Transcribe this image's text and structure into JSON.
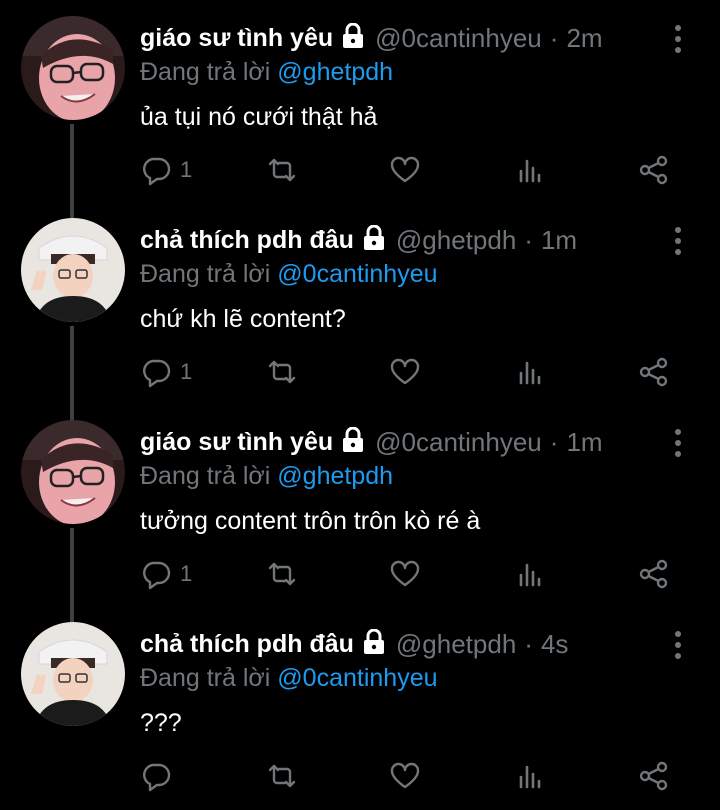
{
  "tweets": [
    {
      "name": "giáo sư tình yêu",
      "handle": "@0cantinhyeu",
      "dot": "·",
      "time": "2m",
      "reply_prefix": "Đang trả lời",
      "reply_to": "@ghetpdh",
      "text": "ủa tụi nó cưới thật hả",
      "reply_count": "1",
      "avatar": "pink-glasses-avatar"
    },
    {
      "name": "chả thích pdh đâu",
      "handle": "@ghetpdh",
      "dot": "·",
      "time": "1m",
      "reply_prefix": "Đang trả lời",
      "reply_to": "@0cantinhyeu",
      "text": "chứ kh lẽ content?",
      "reply_count": "1",
      "avatar": "peace-sign-avatar"
    },
    {
      "name": "giáo sư tình yêu",
      "handle": "@0cantinhyeu",
      "dot": "·",
      "time": "1m",
      "reply_prefix": "Đang trả lời",
      "reply_to": "@ghetpdh",
      "text": "tưởng content trôn trôn kò ré à",
      "reply_count": "1",
      "avatar": "pink-glasses-avatar"
    },
    {
      "name": "chả thích pdh đâu",
      "handle": "@ghetpdh",
      "dot": "·",
      "time": "4s",
      "reply_prefix": "Đang trả lời",
      "reply_to": "@0cantinhyeu",
      "text": "???",
      "reply_count": "",
      "avatar": "peace-sign-avatar"
    }
  ],
  "colors": {
    "background": "#000000",
    "text": "#ffffff",
    "muted": "#71767b",
    "mention": "#1d9bf0",
    "thread_line": "#3e4144"
  }
}
